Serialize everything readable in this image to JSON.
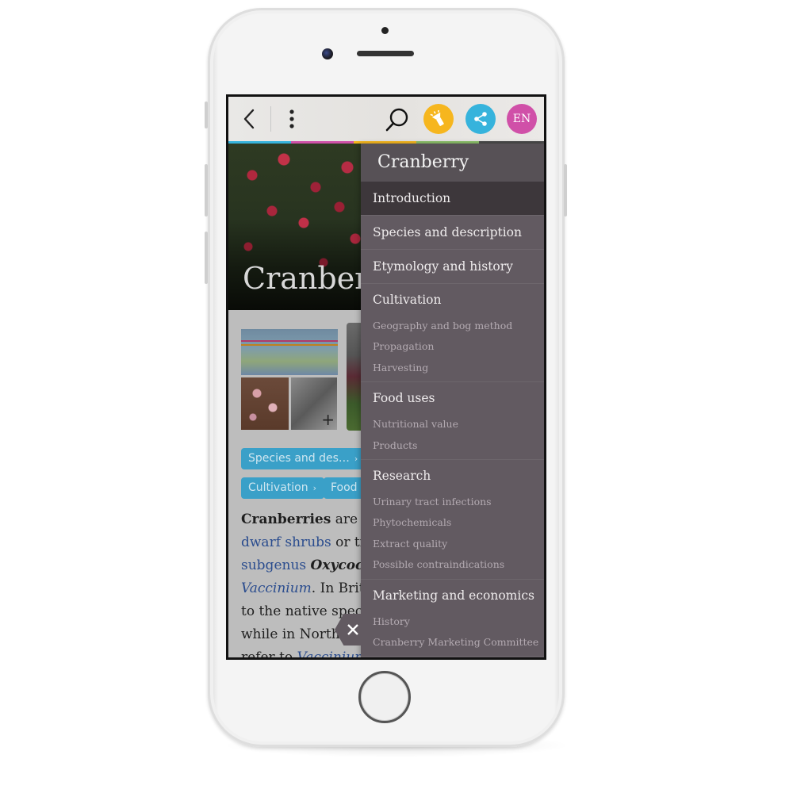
{
  "toolbar": {
    "back_icon": "chevron-left-icon",
    "more_icon": "vertical-dots-icon",
    "search_icon": "search-icon",
    "torch_icon": "flashlight-icon",
    "share_icon": "share-icon",
    "language_label": "EN",
    "colors": {
      "torch": "#f6b61e",
      "share": "#36b3dc",
      "language": "#d050a8"
    },
    "progress_colors": [
      "#36b3dc",
      "#d050a8",
      "#f6b61e",
      "#8cc06a"
    ]
  },
  "article": {
    "hero_title": "Cranberry",
    "chips": [
      {
        "label": "Species and des…",
        "arrow": "›"
      },
      {
        "label": "Cultivation",
        "arrow": "›"
      },
      {
        "label": "Food",
        "arrow": ""
      }
    ],
    "paragraph": {
      "line1": {
        "bold": "Cranberries",
        "text": " are a"
      },
      "line2": {
        "link": "dwarf shrubs",
        "text": " or tr"
      },
      "line3": {
        "link": "subgenus",
        "text": " ",
        "bold_italic": "Oxycocc"
      },
      "line4": {
        "link_italic": "Vaccinium",
        "text": ". In Brit"
      },
      "line5": {
        "text": "to the native spec"
      },
      "line6": {
        "text": "while in North"
      },
      "line7": {
        "text": "refer to ",
        "link_italic": "Vaccinium"
      }
    }
  },
  "toc": {
    "title": "Cranberry",
    "items": [
      {
        "label": "Introduction",
        "active": true
      },
      {
        "label": "Species and description"
      },
      {
        "label": "Etymology and history"
      }
    ],
    "groups": [
      {
        "label": "Cultivation",
        "subitems": [
          "Geography and bog method",
          "Propagation",
          "Harvesting"
        ]
      },
      {
        "label": "Food uses",
        "subitems": [
          "Nutritional value",
          "Products"
        ]
      },
      {
        "label": "Research",
        "subitems": [
          "Urinary tract infections",
          "Phytochemicals",
          "Extract quality",
          "Possible contraindications"
        ]
      },
      {
        "label": "Marketing and economics",
        "subitems": [
          "History",
          "Cranberry Marketing Committee"
        ]
      }
    ],
    "close_icon": "close-icon"
  }
}
